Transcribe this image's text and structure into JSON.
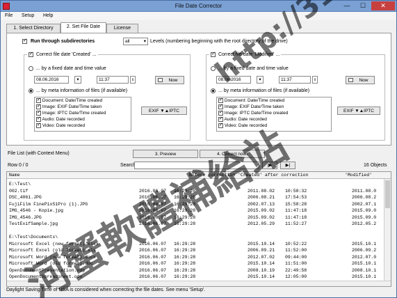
{
  "window": {
    "title": "File Date Corrector",
    "minimize": "—",
    "maximize": "☐",
    "close": "✕"
  },
  "menu": {
    "file": "File",
    "setup": "Setup",
    "help": "Help"
  },
  "tabs": [
    "1. Select Directory",
    "2. Set File Date",
    "License"
  ],
  "options": {
    "subdirs_label": "Run through subdirectories",
    "levels_value": "all",
    "levels_label": "Levels (numbering beginning with the root directory of the drive)"
  },
  "created": {
    "title": "Correct file date 'Created' ...",
    "fixed_label": "... by a fixed date and time value",
    "date": "08.06.2016",
    "time": "11:37",
    "now_button": "Now",
    "meta_label": "... by meta information of files (if available)",
    "items": [
      "Document: Date/Time created",
      "Image: EXIF Date/Time taken",
      "Image: IPTC Date/Time created",
      "Audio: Date recorded",
      "Video: Date recorded"
    ],
    "order_button": "EXIF ▼▲IPTC"
  },
  "modified": {
    "title": "Correct file date 'Modified' ...",
    "fixed_label": "... by a fixed date and time value",
    "date": "08.06.2016",
    "time": "11:37",
    "now_button": "Now",
    "meta_label": "... by meta information of files (if available)",
    "items": [
      "Document: Date/Time created",
      "Image: EXIF Date/Time taken",
      "Image: IPTC Date/Time created",
      "Audio: Date recorded",
      "Video: Date recorded"
    ],
    "order_button": "EXIF ▼▲IPTC"
  },
  "actions": {
    "list_label": "File List (with Context Menu)",
    "preview_button": "3. Preview",
    "correct_button": "4. Correct now!",
    "row_label": "Row 0 / 0",
    "search_label": "Search",
    "search_value": "",
    "next_button": "|▶",
    "last_button": "▶|",
    "objects_label": "16 Objects"
  },
  "filelist": {
    "columns": [
      "Name",
      "",
      "",
      "Before correction",
      "'Created' after correction",
      "'Modified'"
    ],
    "rows": [
      {
        "name": "E:\\Test\\",
        "d1": "",
        "t1": "",
        "d2": "",
        "t2": "",
        "d3": ""
      },
      {
        "name": "002.tif",
        "d1": "2016.06.07",
        "t1": "16:29:28",
        "d2": "2011.08.02",
        "t2": "10:58:32",
        "d3": "2011.08.0"
      },
      {
        "name": "DSC_4061.JPG",
        "d1": "2016.06.07",
        "t1": "16:29:28",
        "d2": "2006.08.21",
        "t2": "17:54:53",
        "d3": "2006.08.2"
      },
      {
        "name": "FujiFilm FinePixS1Pro (1).JPG",
        "d1": "2016.06.07",
        "t1": "16:29:28",
        "d2": "2002.07.13",
        "t2": "15:58:28",
        "d3": "2002.07.1"
      },
      {
        "name": "IMG_4546 - Kopie.jpg",
        "d1": "2016.06.07",
        "t1": "16:29:28",
        "d2": "2015.09.02",
        "t2": "11:47:18",
        "d3": "2015.09.0"
      },
      {
        "name": "IMG_4546.JPG",
        "d1": "2016.06.07",
        "t1": "16:29:28",
        "d2": "2015.09.02",
        "t2": "11:47:18",
        "d3": "2015.09.0"
      },
      {
        "name": "TestExifSample.jpg",
        "d1": "2016.06.07",
        "t1": "16:29:28",
        "d2": "2012.05.29",
        "t2": "11:52:27",
        "d3": "2012.05.2"
      },
      {
        "name": "",
        "d1": "",
        "t1": "",
        "d2": "",
        "t2": "",
        "d3": ""
      },
      {
        "name": "E:\\Test\\Documents\\",
        "d1": "",
        "t1": "",
        "d2": "",
        "t2": "",
        "d3": ""
      },
      {
        "name": "Microsoft Excel (new format).xlsx",
        "d1": "2016.06.07",
        "t1": "16:29:28",
        "d2": "2015.10.14",
        "t2": "10:52:22",
        "d3": "2015.10.1"
      },
      {
        "name": "Microsoft Excel (old format).xls",
        "d1": "2016.06.07",
        "t1": "16:29:28",
        "d2": "2006.09.21",
        "t2": "11:52:00",
        "d3": "2006.09.2"
      },
      {
        "name": "Microsoft Word (new format).docx",
        "d1": "2016.06.07",
        "t1": "16:29:28",
        "d2": "2012.07.02",
        "t2": "09:44:00",
        "d3": "2012.07.0"
      },
      {
        "name": "Microsoft Word (old format).doc",
        "d1": "2016.06.07",
        "t1": "16:29:28",
        "d2": "2015.10.14",
        "t2": "11:51:00",
        "d3": "2015.10.1"
      },
      {
        "name": "OpenDocumentPresentation.odp",
        "d1": "2016.06.07",
        "t1": "16:29:28",
        "d2": "2008.10.19",
        "t2": "22:49:58",
        "d3": "2008.10.1"
      },
      {
        "name": "OpenDocumentSpreadsheet.ods",
        "d1": "2016.06.07",
        "t1": "16:29:28",
        "d2": "2015.10.14",
        "t2": "12:05:00",
        "d3": "2015.10.1"
      }
    ]
  },
  "status": "Daylight Saving Time of USA is considered when correcting the file dates. See menu 'Setup'.",
  "watermark": {
    "url": "http://31.to",
    "cjk": "河蟹軟體補給站"
  }
}
